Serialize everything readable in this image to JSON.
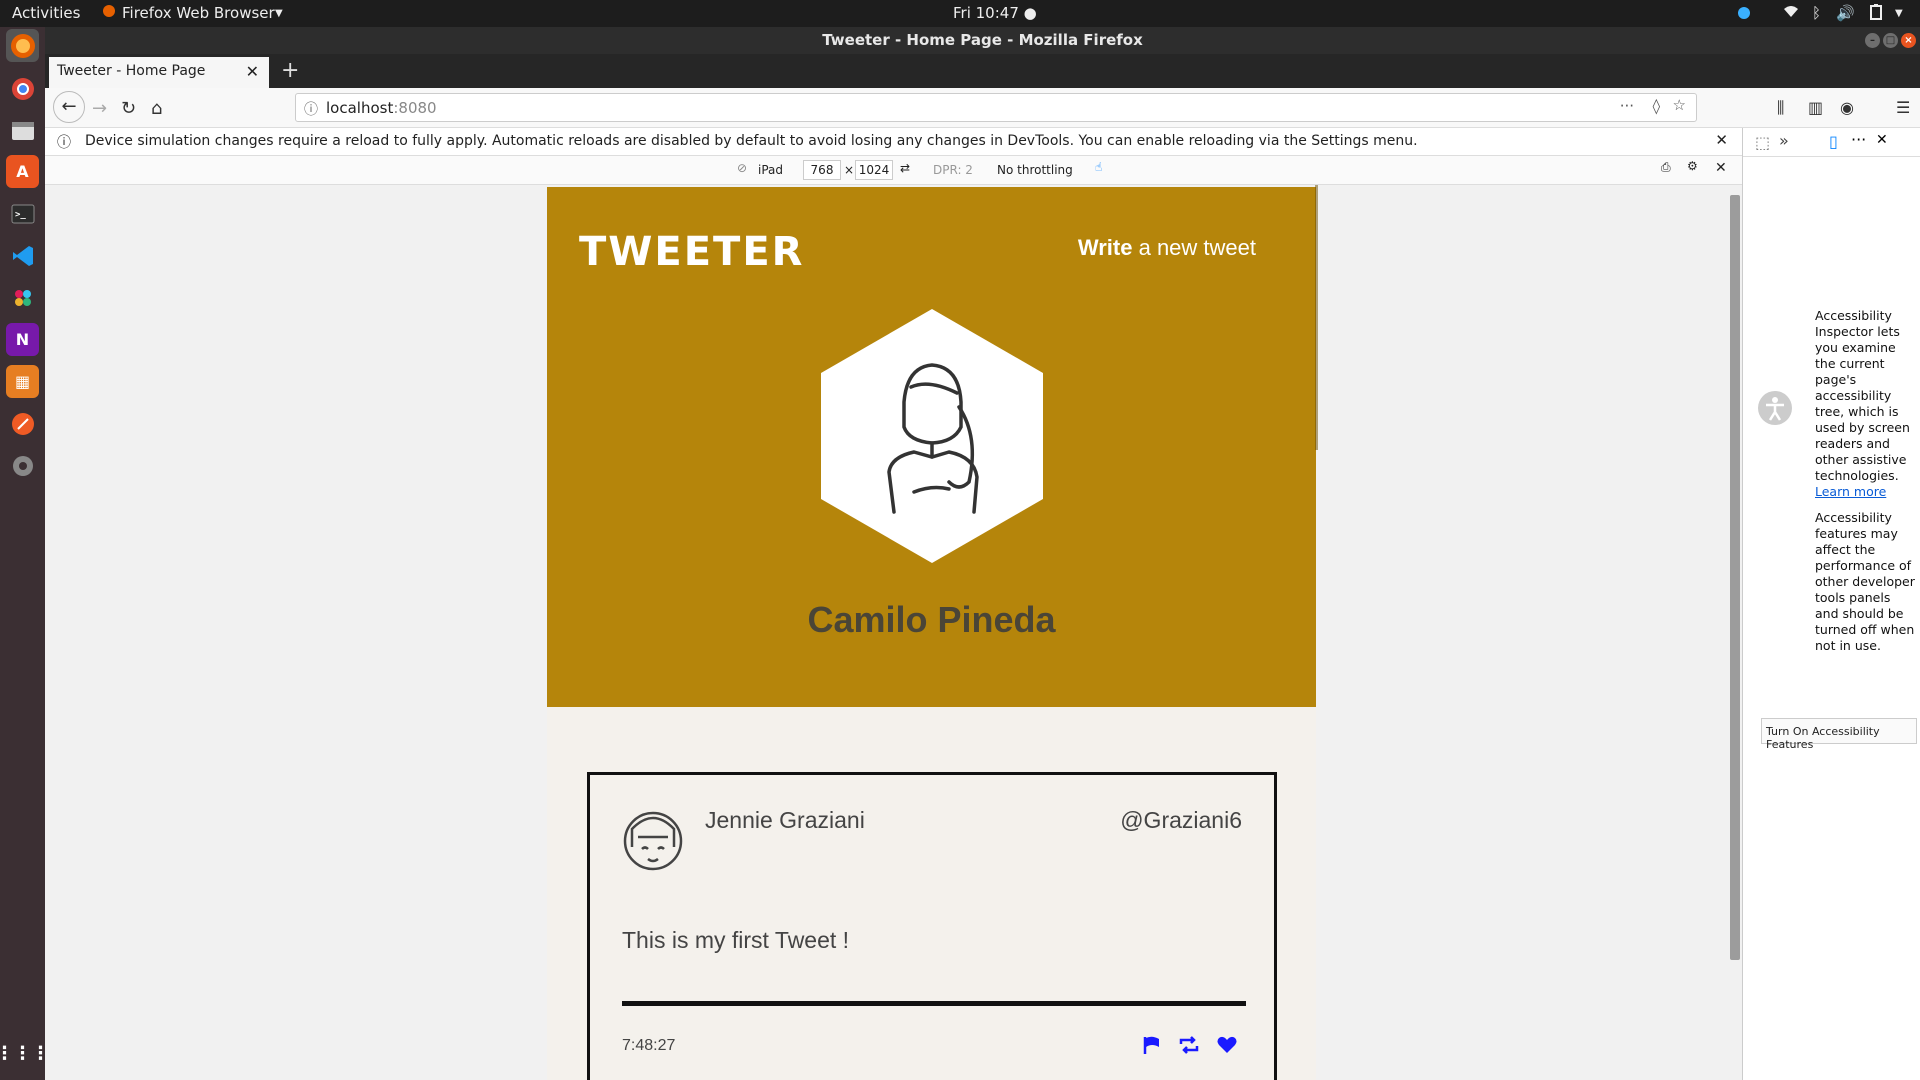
{
  "topbar": {
    "activities": "Activities",
    "app_name": "Firefox Web Browser",
    "clock": "Fri 10:47 ●"
  },
  "window": {
    "title": "Tweeter - Home Page - Mozilla Firefox"
  },
  "tab": {
    "title": "Tweeter - Home Page"
  },
  "navbar": {
    "url_host": "localhost",
    "url_port": ":8080"
  },
  "notice": {
    "text": "Device simulation changes require a reload to fully apply. Automatic reloads are disabled by default to avoid losing any changes in DevTools. You can enable reloading via the Settings menu."
  },
  "rdm": {
    "device": "iPad",
    "width": "768",
    "times": "×",
    "height": "1024",
    "dpr": "DPR: 2",
    "throttling": "No throttling"
  },
  "site": {
    "logo": "TWEETER",
    "write_bold": "Write",
    "write_rest": " a new tweet",
    "profile_name": "Camilo Pineda",
    "tweet": {
      "name": "Jennie Graziani",
      "handle": "@Graziani6",
      "text": "This is my first Tweet !",
      "time": "7:48:27"
    }
  },
  "devtools": {
    "a11y_text": "Accessibility Inspector lets you examine the current page's accessibility tree, which is used by screen readers and other assistive technologies.",
    "learn_more": "Learn more",
    "a11y_warning": "Accessibility features may affect the performance of other developer tools panels and should be turned off when not in use.",
    "turn_on_button": "Turn On Accessibility Features"
  },
  "colors": {
    "header_bg": "#b5850b",
    "action_blue": "#1a1aff"
  }
}
